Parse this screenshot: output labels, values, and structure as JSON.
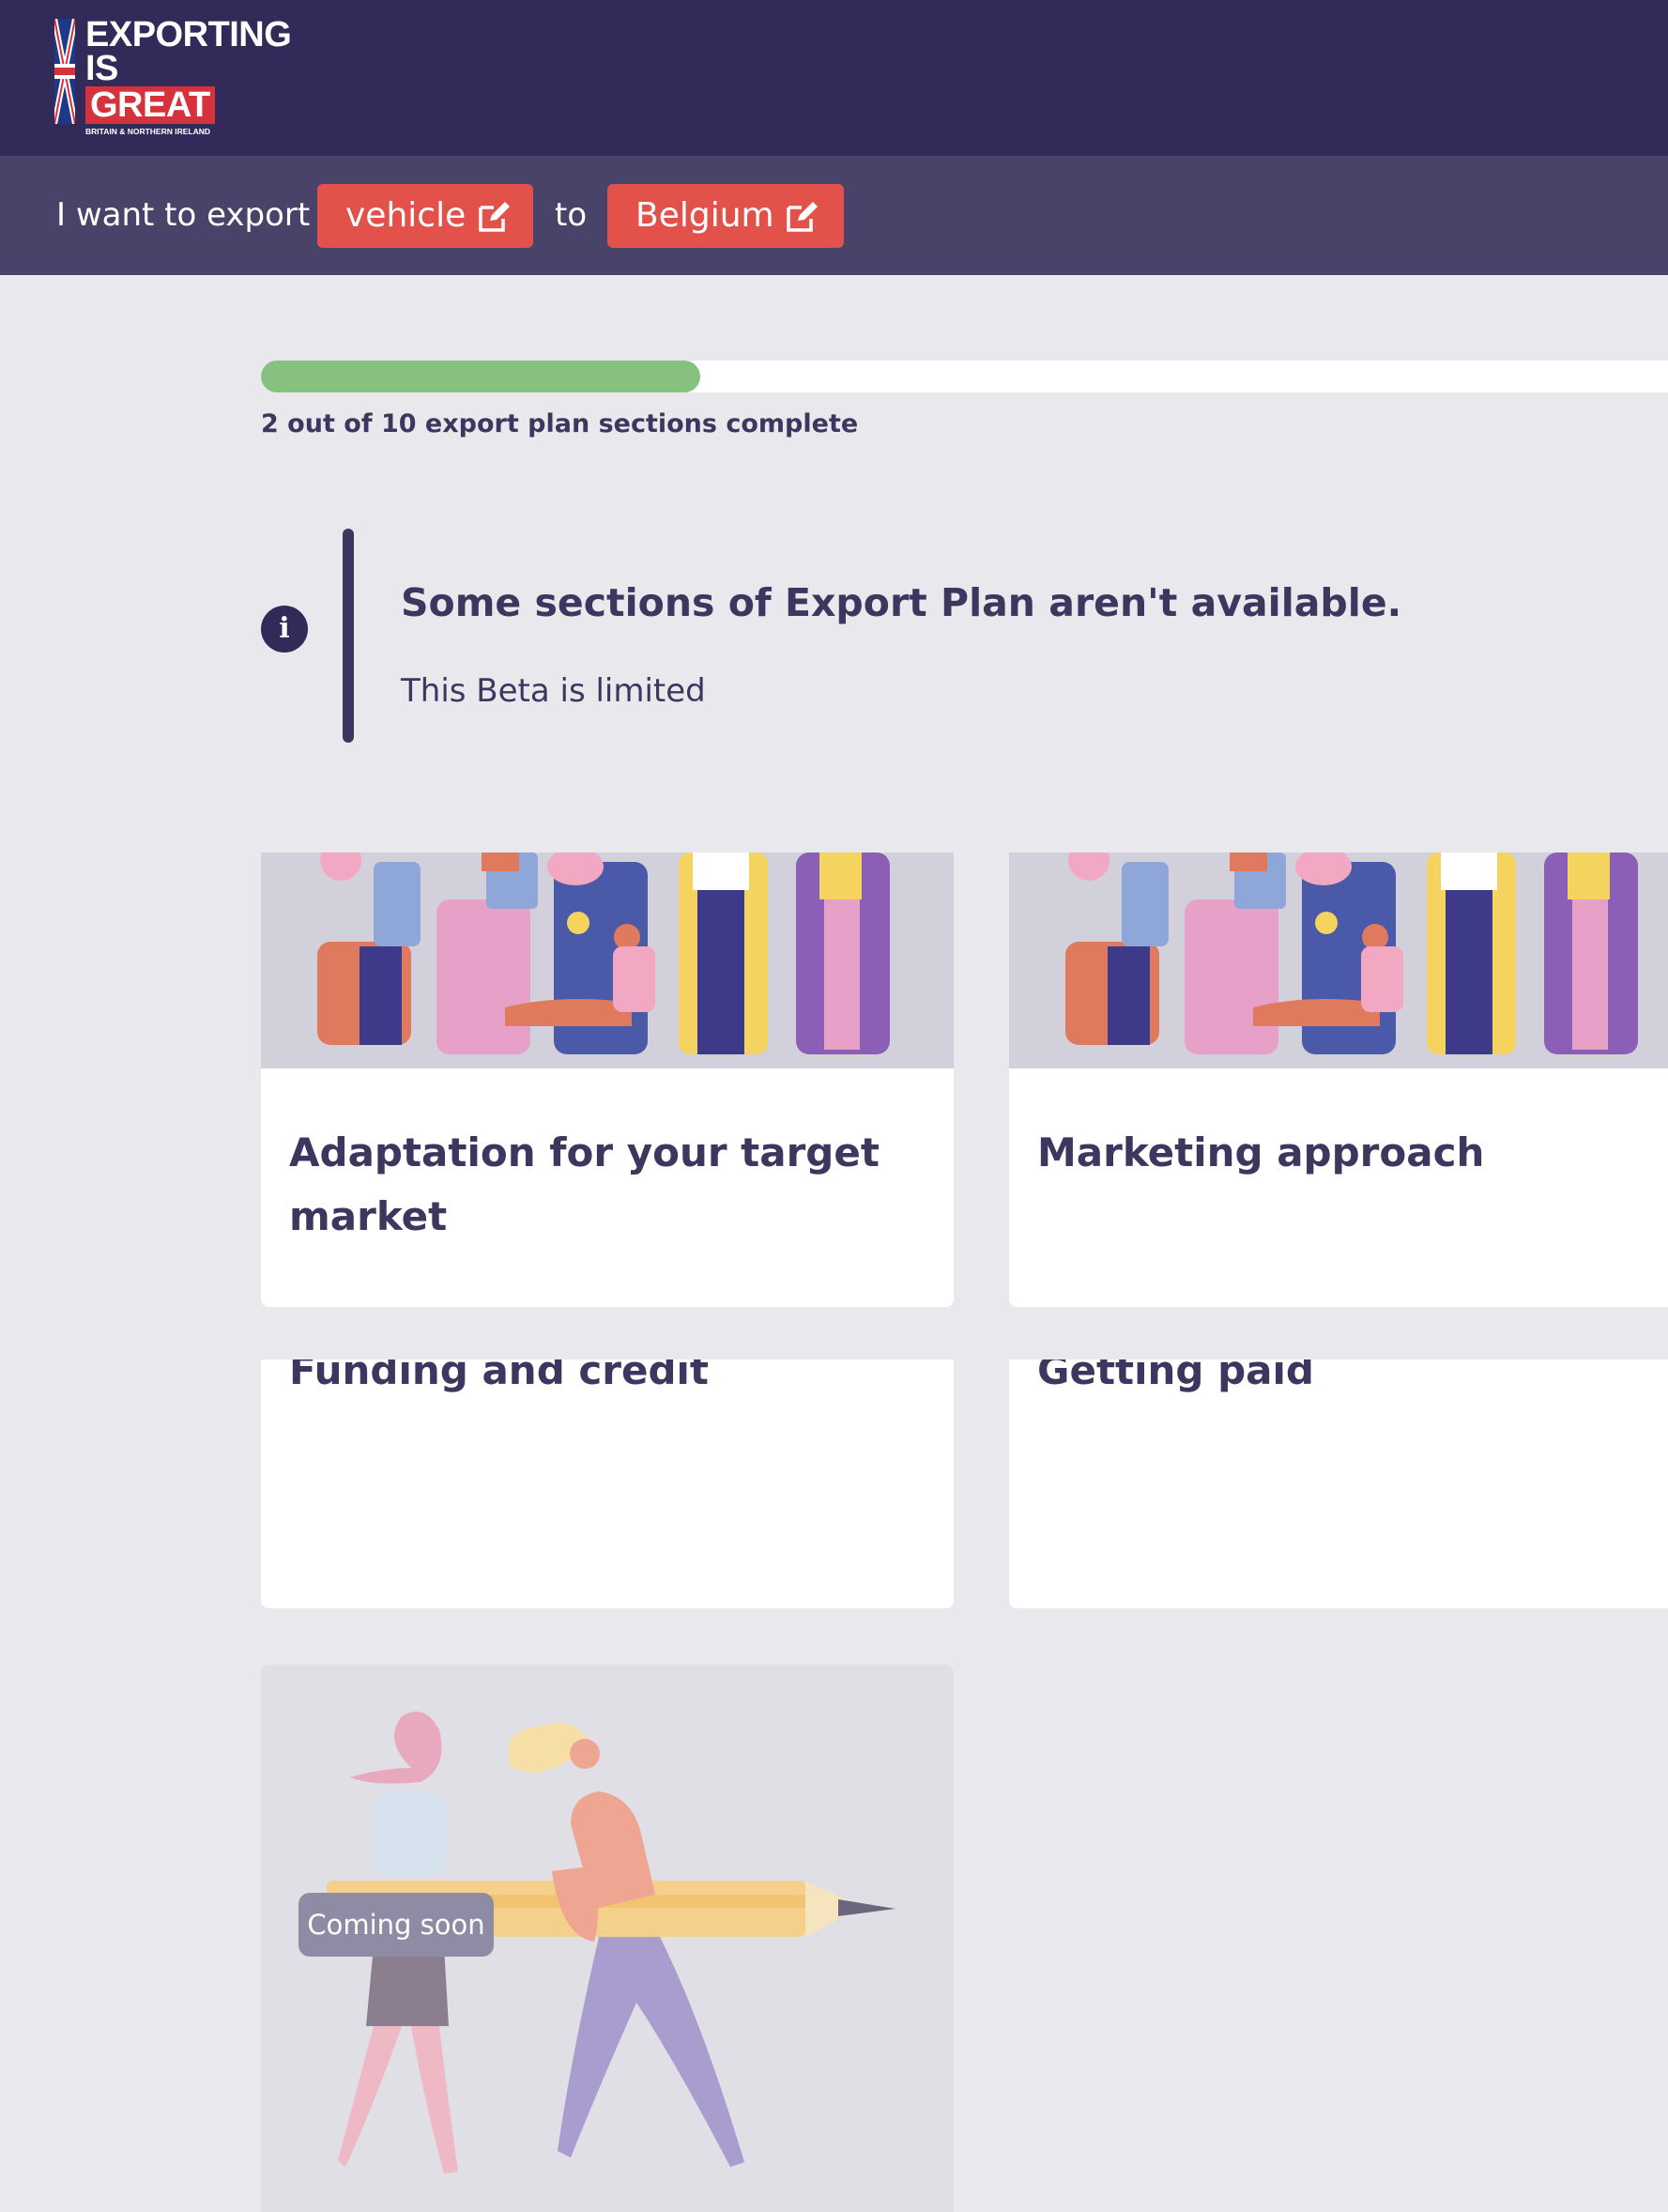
{
  "header": {
    "logo": {
      "line1": "EXPORTING",
      "line2": "IS",
      "line3": "GREAT",
      "subline": "BRITAIN & NORTHERN IRELAND"
    },
    "brand_color": "#322b59"
  },
  "export_bar": {
    "prefix": "I want to export",
    "product": "vehicle",
    "connector": "to",
    "market": "Belgium",
    "pill_color": "#e2524a",
    "edit_icon": "edit-icon"
  },
  "progress": {
    "completed": 2,
    "total": 10,
    "label": "2 out of 10 export plan sections complete",
    "fill_color": "#86c180"
  },
  "notice": {
    "icon": "info-icon",
    "title": "Some sections of Export Plan aren't available.",
    "body": "This Beta is limited"
  },
  "sections": [
    {
      "title_line1": "Adaptation for your target",
      "title_line2": "market"
    },
    {
      "title_line1": "Marketing approach",
      "title_line2": ""
    },
    {
      "title_line1": "Funding and credit",
      "title_line2": ""
    },
    {
      "title_line1": "Getting paid",
      "title_line2": ""
    }
  ],
  "coming_soon": {
    "badge": "Coming soon"
  }
}
